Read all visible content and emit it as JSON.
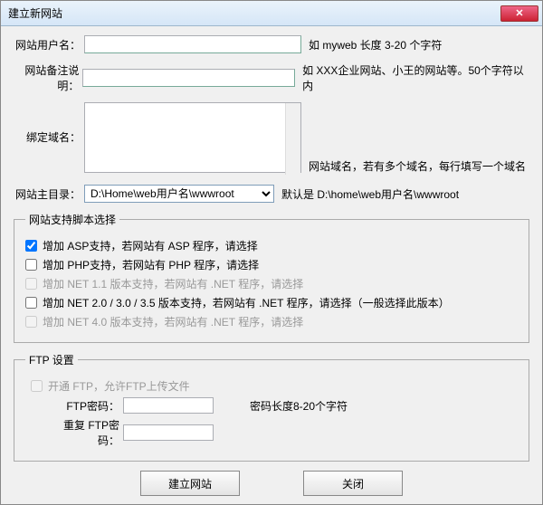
{
  "window": {
    "title": "建立新网站"
  },
  "fields": {
    "username": {
      "label": "网站用户名：",
      "value": "",
      "hint": "如 myweb 长度 3-20 个字符"
    },
    "remark": {
      "label": "网站备注说明：",
      "value": "",
      "hint": "如 XXX企业网站、小王的网站等。50个字符以内"
    },
    "domain": {
      "label": "绑定域名：",
      "value": "",
      "hint": "网站域名，若有多个域名，每行填写一个域名"
    },
    "root": {
      "label": "网站主目录：",
      "value": "D:\\Home\\web用户名\\wwwroot",
      "hint": "默认是 D:\\home\\web用户名\\wwwroot"
    }
  },
  "scripts": {
    "legend": "网站支持脚本选择",
    "items": [
      {
        "label": "增加 ASP支持，若网站有 ASP 程序，请选择",
        "checked": true,
        "enabled": true
      },
      {
        "label": "增加 PHP支持，若网站有 PHP 程序，请选择",
        "checked": false,
        "enabled": true
      },
      {
        "label": "增加 NET 1.1 版本支持，若网站有 .NET 程序，请选择",
        "checked": false,
        "enabled": false
      },
      {
        "label": "增加 NET 2.0 / 3.0 / 3.5 版本支持，若网站有 .NET 程序，请选择（一般选择此版本）",
        "checked": false,
        "enabled": true
      },
      {
        "label": "增加 NET 4.0 版本支持，若网站有 .NET 程序，请选择",
        "checked": false,
        "enabled": false
      }
    ]
  },
  "ftp": {
    "legend": "FTP 设置",
    "enable": {
      "label": "开通 FTP，允许FTP上传文件",
      "checked": false,
      "enabled": false
    },
    "password": {
      "label": "FTP密码：",
      "value": "",
      "hint": "密码长度8-20个字符"
    },
    "password2": {
      "label": "重复 FTP密码：",
      "value": ""
    }
  },
  "buttons": {
    "create": "建立网站",
    "close": "关闭"
  }
}
